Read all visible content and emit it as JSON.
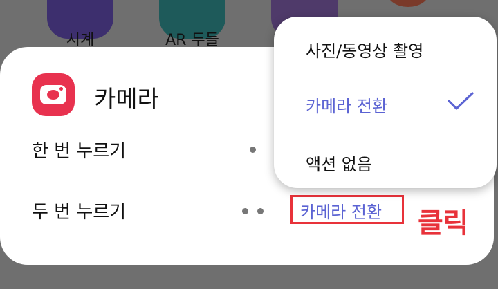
{
  "background_apps": {
    "clock_label": "시계",
    "ar_label": "AR 두들"
  },
  "card": {
    "title": "카메라",
    "icon": "camera-icon",
    "rows": [
      {
        "label": "한 번 누르기"
      },
      {
        "label": "두 번 누르기",
        "value": "카메라 전환"
      }
    ]
  },
  "menu": {
    "items": [
      {
        "label": "사진/동영상 촬영",
        "selected": false
      },
      {
        "label": "카메라 전환",
        "selected": true
      },
      {
        "label": "액션 없음",
        "selected": false
      }
    ]
  },
  "annotation": {
    "click_text": "클릭"
  },
  "colors": {
    "accent": "#5b63d3",
    "annotation": "#e8323a",
    "camera_icon": "#e8324f"
  }
}
